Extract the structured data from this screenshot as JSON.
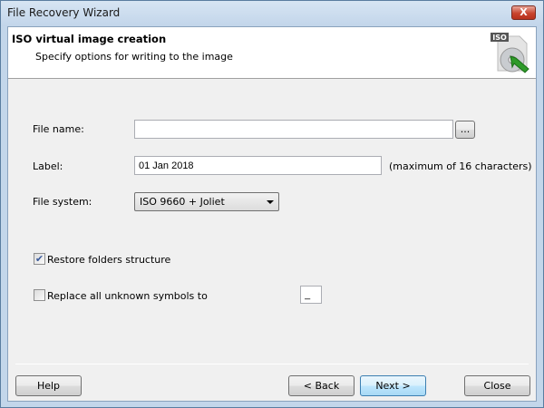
{
  "window": {
    "title": "File Recovery Wizard",
    "close_label": "X"
  },
  "header": {
    "title": "ISO virtual image creation",
    "subtitle": "Specify options for writing to the image",
    "icon_text": "ISO"
  },
  "form": {
    "file_name": {
      "label": "File name:",
      "value": "",
      "browse_label": "..."
    },
    "label": {
      "label": "Label:",
      "value": "01 Jan 2018",
      "hint": "(maximum of 16 characters)"
    },
    "file_system": {
      "label": "File system:",
      "value": "ISO 9660 + Joliet"
    },
    "restore_folders": {
      "label": "Restore folders structure",
      "checked": true,
      "mark": "✔"
    },
    "replace_symbols": {
      "label": "Replace all unknown symbols to",
      "checked": false,
      "value": "_"
    }
  },
  "buttons": {
    "help": "Help",
    "back": "< Back",
    "next": "Next >",
    "close": "Close"
  }
}
